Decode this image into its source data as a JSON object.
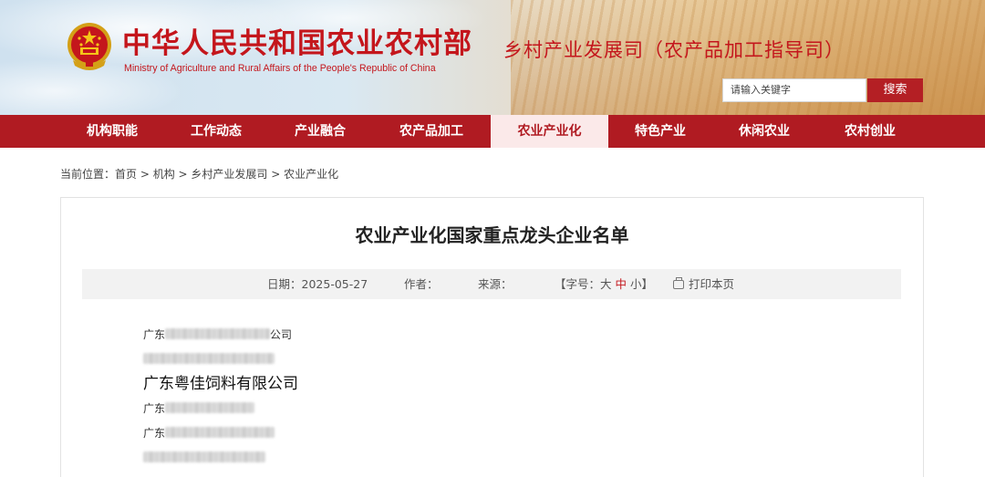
{
  "header": {
    "ministry_cn": "中华人民共和国农业农村部",
    "ministry_en": "Ministry of Agriculture and Rural Affairs of the People's Republic of China",
    "department": "乡村产业发展司（农产品加工指导司）",
    "search_placeholder": "请输入关键字",
    "search_button": "搜索",
    "emblem_icon": "national-emblem-icon"
  },
  "nav": {
    "items": [
      {
        "label": "机构职能"
      },
      {
        "label": "工作动态"
      },
      {
        "label": "产业融合"
      },
      {
        "label": "农产品加工"
      },
      {
        "label": "农业产业化"
      },
      {
        "label": "特色产业"
      },
      {
        "label": "休闲农业"
      },
      {
        "label": "农村创业"
      }
    ],
    "active_index": 4
  },
  "breadcrumb": {
    "prefix": "当前位置：",
    "items": [
      "首页",
      "机构",
      "乡村产业发展司",
      "农业产业化"
    ],
    "separator": " > "
  },
  "article": {
    "title": "农业产业化国家重点龙头企业名单",
    "date_label": "日期：",
    "date": "2025-05-27",
    "author_label": "作者：",
    "source_label": "来源：",
    "fontsize_open": "【字号：",
    "fontsize_big": "大",
    "fontsize_mid": "中",
    "fontsize_small": "小",
    "fontsize_close": "】",
    "print_label": "打印本页"
  },
  "companies": [
    {
      "prefix": "广东",
      "suffix": "公司",
      "blurred": true
    },
    {
      "prefix": "",
      "suffix": "",
      "blurred": true
    },
    {
      "prefix": "广东粤佳饲料有限公司",
      "suffix": "",
      "blurred": false
    },
    {
      "prefix": "广东",
      "suffix": "",
      "blurred": true
    },
    {
      "prefix": "广东",
      "suffix": "",
      "blurred": true
    },
    {
      "prefix": "",
      "suffix": "",
      "blurred": true
    }
  ],
  "colors": {
    "brand_red": "#b01b22",
    "title_red": "#c4161c",
    "nav_active_bg": "#fbe9e9"
  }
}
